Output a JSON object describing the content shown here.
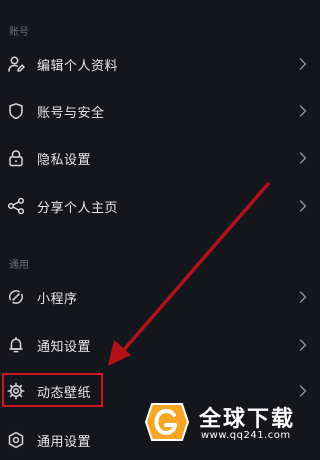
{
  "sections": {
    "account": {
      "header": "账号"
    },
    "general": {
      "header": "通用"
    }
  },
  "items": {
    "edit_profile": {
      "label": "编辑个人资料",
      "icon": "user-edit-icon"
    },
    "account_security": {
      "label": "账号与安全",
      "icon": "shield-icon"
    },
    "privacy": {
      "label": "隐私设置",
      "icon": "lock-icon"
    },
    "share_profile": {
      "label": "分享个人主页",
      "icon": "share-icon"
    },
    "mini_program": {
      "label": "小程序",
      "icon": "mini-program-icon"
    },
    "notifications": {
      "label": "通知设置",
      "icon": "bell-icon"
    },
    "live_wallpaper": {
      "label": "动态壁纸",
      "icon": "wallpaper-gear-icon"
    },
    "general_settings": {
      "label": "通用设置",
      "icon": "settings-icon"
    }
  },
  "annotation": {
    "highlight_color": "#d01822",
    "target": "动态壁纸"
  },
  "watermark": {
    "title": "全球下载",
    "url": "www.qq241.com",
    "logo_color": "#f5a623"
  },
  "colors": {
    "background": "#15161c",
    "text": "#e6e6e8",
    "muted": "#6c6e76"
  }
}
